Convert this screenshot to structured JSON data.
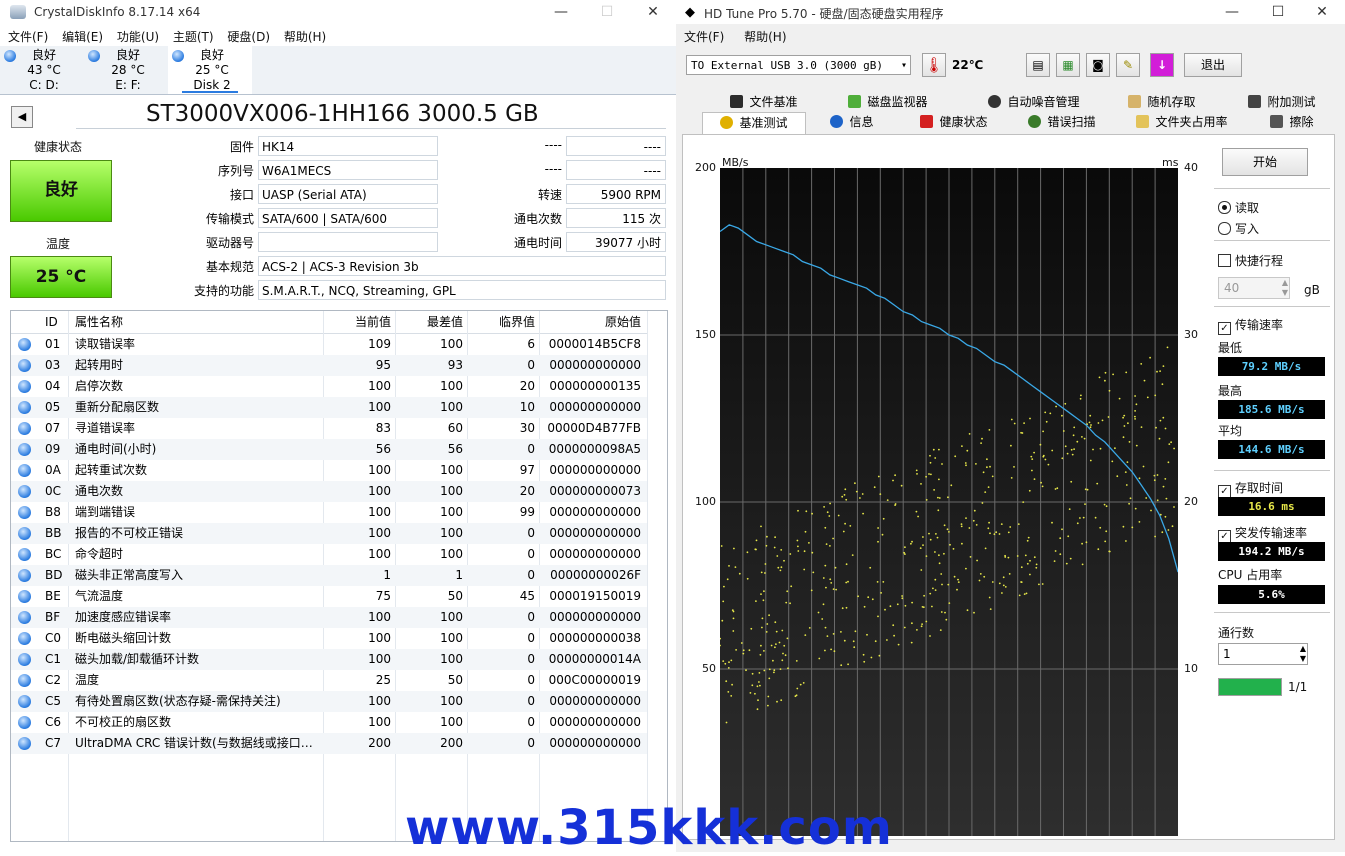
{
  "cdi": {
    "title": "CrystalDiskInfo 8.17.14 x64",
    "min_icon": "minimize-icon",
    "menu": [
      "文件(F)",
      "编辑(E)",
      "功能(U)",
      "主题(T)",
      "硬盘(D)",
      "帮助(H)"
    ],
    "disks": [
      {
        "status": "良好",
        "temp": "43 °C",
        "name": "C: D:"
      },
      {
        "status": "良好",
        "temp": "28 °C",
        "name": "E: F:"
      },
      {
        "status": "良好",
        "temp": "25 °C",
        "name": "Disk 2"
      }
    ],
    "model": "ST3000VX006-1HH166 3000.5 GB",
    "health_label": "健康状态",
    "health_value": "良好",
    "temp_label": "温度",
    "temp_value": "25 °C",
    "info_left": [
      {
        "label": "固件",
        "value": "HK14"
      },
      {
        "label": "序列号",
        "value": "W6A1MECS"
      },
      {
        "label": "接口",
        "value": "UASP (Serial ATA)"
      },
      {
        "label": "传输模式",
        "value": "SATA/600 | SATA/600"
      },
      {
        "label": "驱动器号",
        "value": ""
      },
      {
        "label": "基本规范",
        "value": "ACS-2 | ACS-3 Revision 3b"
      },
      {
        "label": "支持的功能",
        "value": "S.M.A.R.T., NCQ, Streaming, GPL"
      }
    ],
    "info_right": [
      {
        "label": "----",
        "value": "----"
      },
      {
        "label": "----",
        "value": "----"
      },
      {
        "label": "转速",
        "value": "5900 RPM"
      },
      {
        "label": "通电次数",
        "value": "115 次"
      },
      {
        "label": "通电时间",
        "value": "39077 小时"
      }
    ],
    "table_headers": [
      "ID",
      "属性名称",
      "当前值",
      "最差值",
      "临界值",
      "原始值"
    ],
    "rows": [
      [
        "01",
        "读取错误率",
        "109",
        "100",
        "6",
        "0000014B5CF8"
      ],
      [
        "03",
        "起转用时",
        "95",
        "93",
        "0",
        "000000000000"
      ],
      [
        "04",
        "启停次数",
        "100",
        "100",
        "20",
        "000000000135"
      ],
      [
        "05",
        "重新分配扇区数",
        "100",
        "100",
        "10",
        "000000000000"
      ],
      [
        "07",
        "寻道错误率",
        "83",
        "60",
        "30",
        "00000D4B77FB"
      ],
      [
        "09",
        "通电时间(小时)",
        "56",
        "56",
        "0",
        "0000000098A5"
      ],
      [
        "0A",
        "起转重试次数",
        "100",
        "100",
        "97",
        "000000000000"
      ],
      [
        "0C",
        "通电次数",
        "100",
        "100",
        "20",
        "000000000073"
      ],
      [
        "B8",
        "端到端错误",
        "100",
        "100",
        "99",
        "000000000000"
      ],
      [
        "BB",
        "报告的不可校正错误",
        "100",
        "100",
        "0",
        "000000000000"
      ],
      [
        "BC",
        "命令超时",
        "100",
        "100",
        "0",
        "000000000000"
      ],
      [
        "BD",
        "磁头非正常高度写入",
        "1",
        "1",
        "0",
        "00000000026F"
      ],
      [
        "BE",
        "气流温度",
        "75",
        "50",
        "45",
        "000019150019"
      ],
      [
        "BF",
        "加速度感应错误率",
        "100",
        "100",
        "0",
        "000000000000"
      ],
      [
        "C0",
        "断电磁头缩回计数",
        "100",
        "100",
        "0",
        "000000000038"
      ],
      [
        "C1",
        "磁头加载/卸载循环计数",
        "100",
        "100",
        "0",
        "00000000014A"
      ],
      [
        "C2",
        "温度",
        "25",
        "50",
        "0",
        "000C00000019"
      ],
      [
        "C5",
        "有待处置扇区数(状态存疑-需保持关注)",
        "100",
        "100",
        "0",
        "000000000000"
      ],
      [
        "C6",
        "不可校正的扇区数",
        "100",
        "100",
        "0",
        "000000000000"
      ],
      [
        "C7",
        "UltraDMA CRC 错误计数(与数据线或接口…",
        "200",
        "200",
        "0",
        "000000000000"
      ]
    ]
  },
  "hdt": {
    "title": "HD Tune Pro 5.70 - 硬盘/固态硬盘实用程序",
    "menu": [
      "文件(F)",
      "帮助(H)"
    ],
    "drive": "TO External USB 3.0 (3000 gB)",
    "temperature": "22℃",
    "exit_label": "退出",
    "tabs_top": [
      "文件基准",
      "磁盘监视器",
      "自动噪音管理",
      "随机存取",
      "附加测试"
    ],
    "tabs_bottom": [
      "基准测试",
      "信息",
      "健康状态",
      "错误扫描",
      "文件夹占用率",
      "擦除"
    ],
    "start_label": "开始",
    "read_label": "读取",
    "write_label": "写入",
    "quick_label": "快捷行程",
    "quick_value": "40",
    "quick_unit": "gB",
    "transfer_label": "传输速率",
    "min_label": "最低",
    "min_value": "79.2 MB/s",
    "max_label": "最高",
    "max_value": "185.6 MB/s",
    "avg_label": "平均",
    "avg_value": "144.6 MB/s",
    "access_label": "存取时间",
    "access_value": "16.6 ms",
    "burst_label": "突发传输速率",
    "burst_value": "194.2 MB/s",
    "cpu_label": "CPU 占用率",
    "cpu_value": "5.6%",
    "passes_label": "通行数",
    "passes_value": "1",
    "progress_text": "1/1",
    "progress_fraction": 1.0,
    "graph_unit_left": "MB/s",
    "graph_unit_right": "ms",
    "y_left_ticks": [
      "200",
      "150",
      "100",
      "50"
    ],
    "y_right_ticks": [
      "40",
      "30",
      "20",
      "10"
    ],
    "colors": {
      "transfer_line": "#3aa8e6",
      "access_dots": "#e8e84a",
      "progress": "#22b14c"
    }
  },
  "watermark": "www.315kkk.com",
  "chart_data": {
    "type": "line",
    "y_left_label": "MB/s",
    "y_right_label": "ms",
    "ylim_left": [
      0,
      200
    ],
    "ylim_right": [
      0,
      40
    ],
    "grid": true,
    "series": [
      {
        "axis": "left",
        "x": [
          0,
          2,
          4,
          6,
          8,
          10,
          12,
          14,
          16,
          18,
          20,
          22,
          24,
          26,
          28,
          30,
          32,
          34,
          36,
          38,
          40,
          42,
          44,
          46,
          48,
          50,
          52,
          54,
          56,
          58,
          60,
          62,
          64,
          66,
          68,
          70,
          72,
          74,
          76,
          78,
          80,
          82,
          84,
          86,
          88,
          90,
          92,
          94,
          96,
          98,
          100
        ],
        "values": [
          181,
          183,
          182,
          180,
          178,
          177,
          176,
          175,
          174,
          172,
          171,
          170,
          168,
          167,
          166,
          165,
          164,
          162,
          161,
          159,
          157,
          156,
          154,
          153,
          152,
          150,
          149,
          147,
          146,
          144,
          142,
          141,
          139,
          137,
          135,
          133,
          131,
          129,
          127,
          125,
          123,
          120,
          118,
          115,
          112,
          109,
          105,
          101,
          96,
          89,
          79
        ]
      }
    ]
  }
}
